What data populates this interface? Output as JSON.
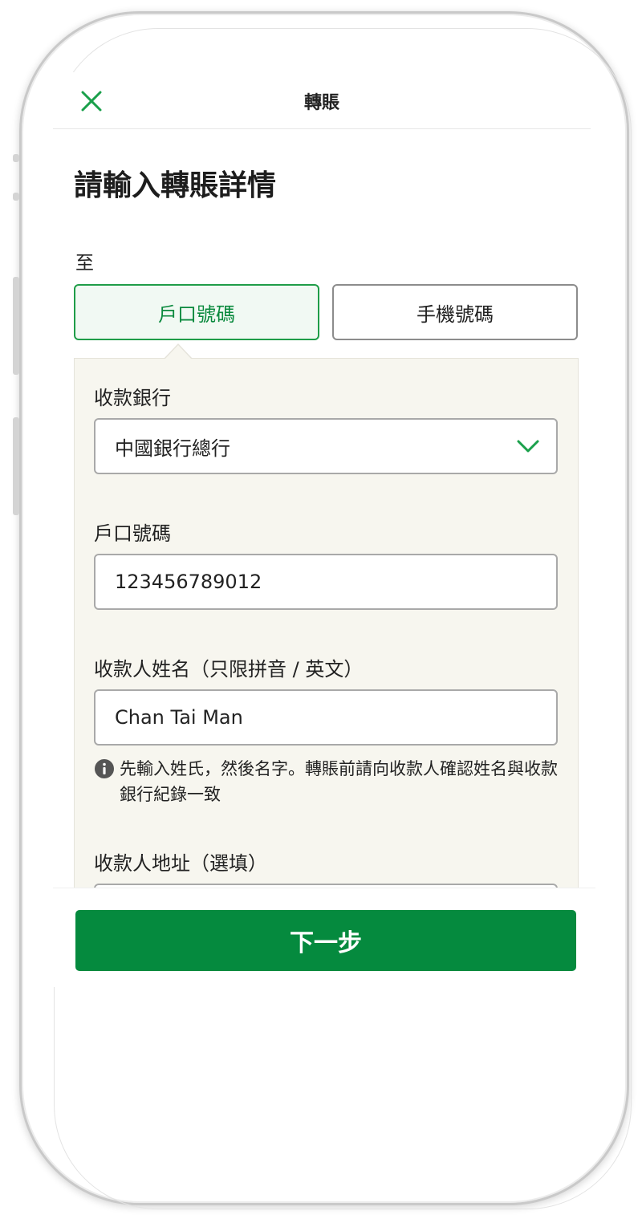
{
  "header": {
    "title": "轉賬",
    "close_icon": "close-icon"
  },
  "page_title": "請輸入轉賬詳情",
  "to_label": "至",
  "tabs": [
    {
      "label": "戶口號碼",
      "active": true
    },
    {
      "label": "手機號碼",
      "active": false
    }
  ],
  "form": {
    "bank": {
      "label": "收款銀行",
      "value": "中國銀行總行",
      "icon": "chevron-down-icon"
    },
    "account": {
      "label": "戶口號碼",
      "value": "123456789012"
    },
    "payee_name": {
      "label": "收款人姓名（只限拼音 / 英文）",
      "value": "Chan Tai Man",
      "hint": "先輸入姓氏，然後名字。轉賬前請向收款人確認姓名與收款銀行紀錄一致",
      "hint_icon": "info-icon"
    },
    "address": {
      "label": "收款人地址（選填）",
      "value": ""
    }
  },
  "next_button": "下一步",
  "colors": {
    "accent": "#058a3e",
    "panel_bg": "#f7f6ef",
    "active_tab_bg": "#f1f9f3"
  }
}
